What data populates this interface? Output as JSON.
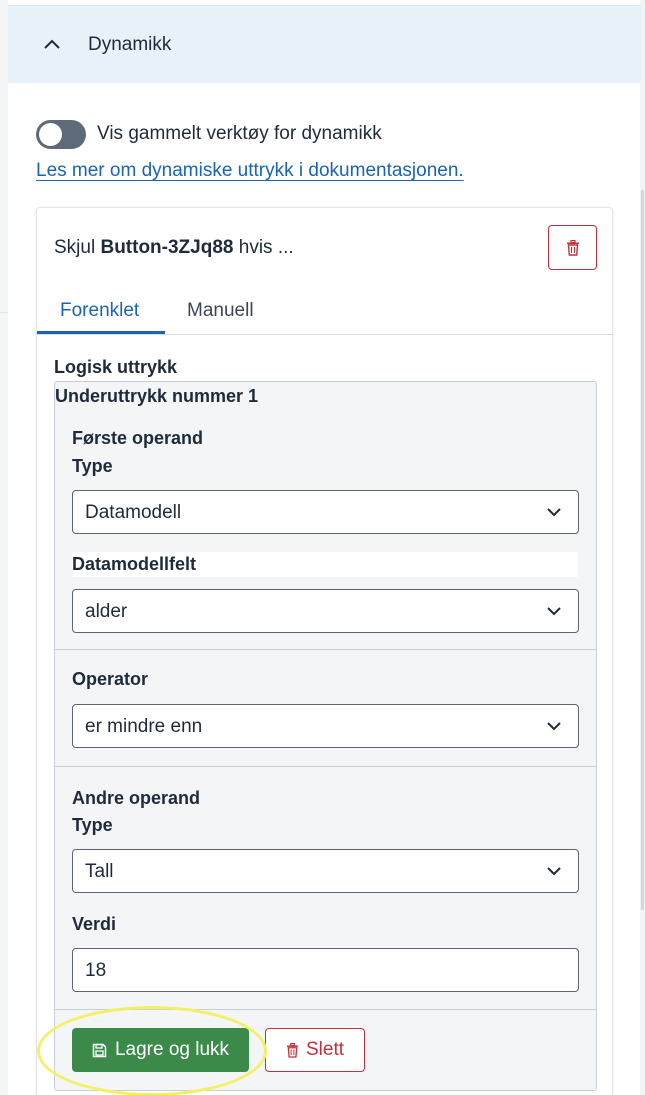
{
  "accordion": {
    "title": "Dynamikk",
    "expanded": true,
    "icon": "chevron-up-icon"
  },
  "toggle": {
    "label": "Vis gammelt verktøy for dynamikk",
    "checked": false
  },
  "doc_link": "Les mer om dynamiske uttrykk i dokumentasjonen.",
  "card": {
    "title_prefix": "Skjul",
    "title_component": "Button-3ZJq88",
    "title_suffix": "hvis ...",
    "delete_icon": "trash-icon",
    "tabs": [
      {
        "label": "Forenklet",
        "active": true
      },
      {
        "label": "Manuell",
        "active": false
      }
    ],
    "section_label": "Logisk uttrykk",
    "subexpression": {
      "title": "Underuttrykk nummer 1",
      "first_operand": {
        "heading": "Første operand",
        "type_label": "Type",
        "type_value": "Datamodell",
        "field_label": "Datamodellfelt",
        "field_value": "alder"
      },
      "operator": {
        "label": "Operator",
        "value": "er mindre enn"
      },
      "second_operand": {
        "heading": "Andre operand",
        "type_label": "Type",
        "type_value": "Tall",
        "value_label": "Verdi",
        "value": "18"
      },
      "save_button": "Lagre og lukk",
      "delete_button": "Slett"
    }
  },
  "colors": {
    "primary": "#1b63b3",
    "success": "#3b8a4a",
    "danger": "#c0313b",
    "highlight": "#f3f065"
  }
}
